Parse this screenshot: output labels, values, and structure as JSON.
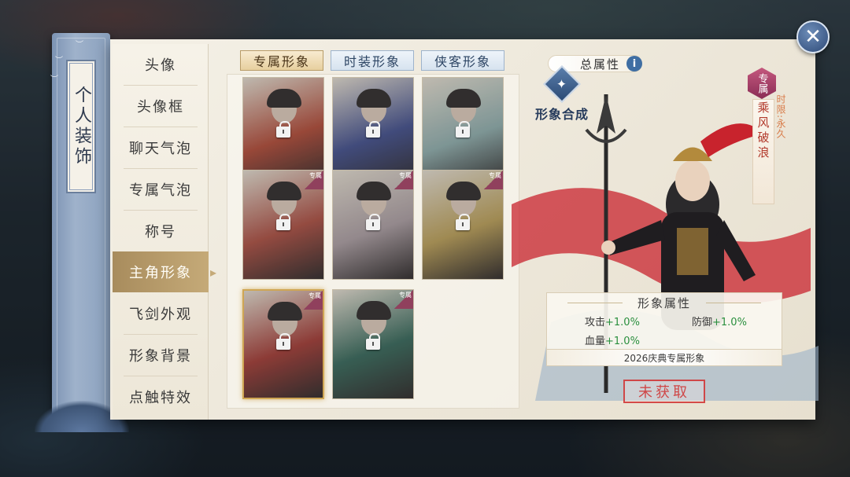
{
  "ribbon": {
    "title": "个人装饰"
  },
  "menu": {
    "items": [
      {
        "label": "头像"
      },
      {
        "label": "头像框"
      },
      {
        "label": "聊天气泡"
      },
      {
        "label": "专属气泡"
      },
      {
        "label": "称号"
      },
      {
        "label": "主角形象"
      },
      {
        "label": "飞剑外观"
      },
      {
        "label": "形象背景"
      },
      {
        "label": "点触特效"
      }
    ],
    "active_index": 5
  },
  "tabs": [
    {
      "label": "专属形象"
    },
    {
      "label": "时装形象"
    },
    {
      "label": "侠客形象"
    }
  ],
  "cards": [
    {
      "badge": "",
      "locked": true,
      "palette": "#c8452d"
    },
    {
      "badge": "",
      "locked": true,
      "palette": "#3d4e9c"
    },
    {
      "badge": "",
      "locked": true,
      "palette": "#8fb6b5"
    },
    {
      "badge": "专属",
      "locked": true,
      "palette": "#c14a3a"
    },
    {
      "badge": "专属",
      "locked": true,
      "palette": "#b3a3a8"
    },
    {
      "badge": "专属",
      "locked": true,
      "palette": "#c8a54a"
    },
    {
      "badge": "专属",
      "locked": true,
      "palette": "#b8342c",
      "selected": true
    },
    {
      "badge": "专属",
      "locked": true,
      "palette": "#2c6b5a"
    }
  ],
  "detail": {
    "total_attr_label": "总属性",
    "info_icon": "i",
    "synth_label": "形象合成",
    "exclusive_tag": "专属",
    "title_main": "乘风破浪",
    "title_sub": "时限:永久",
    "attr_title": "形象属性",
    "attrs": [
      {
        "name": "攻击",
        "value": "+1.0%"
      },
      {
        "name": "防御",
        "value": "+1.0%"
      },
      {
        "name": "血量",
        "value": "+1.0%"
      }
    ],
    "footer": "2026庆典专属形象",
    "stamp": "未获取"
  },
  "colors": {
    "accent_gold": "#c5aa78",
    "tab_blue": "#2d4564",
    "stat_green": "#2a8f3e",
    "stamp_red": "#d23a3a"
  },
  "icons": {
    "close": "close-icon",
    "info": "info-icon",
    "lock": "lock-icon",
    "synth": "synthesis-icon"
  }
}
